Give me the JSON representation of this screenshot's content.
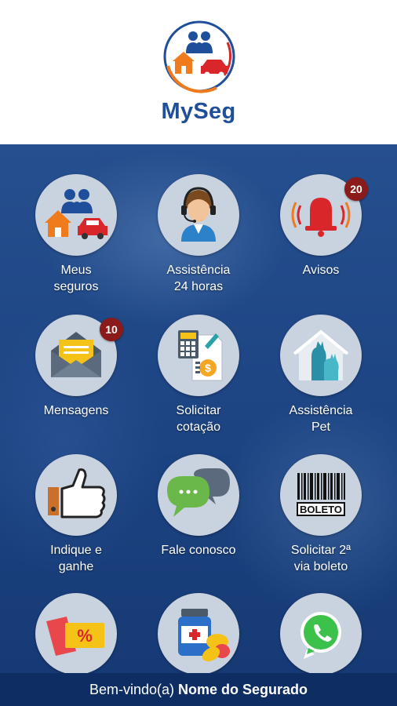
{
  "app": {
    "logo_text": "MySeg"
  },
  "colors": {
    "brand_blue": "#1f4e9b",
    "background_blue": "#1d4584",
    "footer_blue": "#0d2d63",
    "badge_red": "#8b1a1a",
    "accent_orange": "#f07b1c"
  },
  "tiles": [
    {
      "label_line1": "Meus",
      "label_line2": "seguros",
      "icon": "family-house-car-icon"
    },
    {
      "label_line1": "Assistência",
      "label_line2": "24 horas",
      "icon": "headset-agent-icon"
    },
    {
      "label_line1": "Avisos",
      "label_line2": "",
      "icon": "alarm-bell-icon",
      "badge": "20"
    },
    {
      "label_line1": "Mensagens",
      "label_line2": "",
      "icon": "envelope-icon",
      "badge": "10"
    },
    {
      "label_line1": "Solicitar",
      "label_line2": "cotação",
      "icon": "calculator-document-icon"
    },
    {
      "label_line1": "Assistência",
      "label_line2": "Pet",
      "icon": "pet-house-icon"
    },
    {
      "label_line1": "Indique e",
      "label_line2": "ganhe",
      "icon": "thumbs-up-icon"
    },
    {
      "label_line1": "Fale conosco",
      "label_line2": "",
      "icon": "chat-bubbles-icon"
    },
    {
      "label_line1": "Solicitar 2ª",
      "label_line2": "via boleto",
      "icon": "barcode-boleto-icon",
      "icon_text": "BOLETO"
    },
    {
      "label_line1": "",
      "label_line2": "",
      "icon": "discount-coupon-icon",
      "icon_text": "%"
    },
    {
      "label_line1": "",
      "label_line2": "",
      "icon": "medicine-pills-icon"
    },
    {
      "label_line1": "",
      "label_line2": "",
      "icon": "whatsapp-icon"
    }
  ],
  "footer": {
    "greeting": "Bem-vindo(a)",
    "user_name": "Nome do Segurado"
  }
}
